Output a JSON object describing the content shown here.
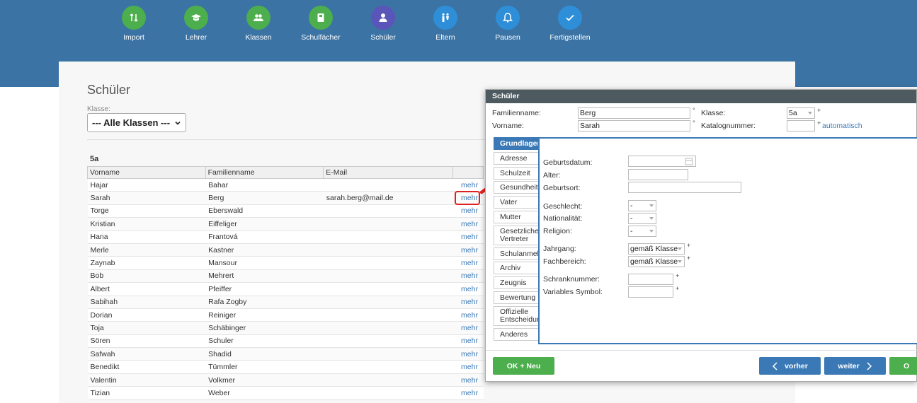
{
  "steps": [
    {
      "label": "Import",
      "icon": "import-arrows-icon",
      "color": "#4cae4c"
    },
    {
      "label": "Lehrer",
      "icon": "graduation-cap-icon",
      "color": "#4cae4c"
    },
    {
      "label": "Klassen",
      "icon": "people-group-icon",
      "color": "#4cae4c"
    },
    {
      "label": "Schulfächer",
      "icon": "book-icon",
      "color": "#4cae4c"
    },
    {
      "label": "Schüler",
      "icon": "person-icon",
      "color": "#5a55b8"
    },
    {
      "label": "Eltern",
      "icon": "parents-icon",
      "color": "#2e8fd8"
    },
    {
      "label": "Pausen",
      "icon": "bell-icon",
      "color": "#2e8fd8"
    },
    {
      "label": "Fertigstellen",
      "icon": "checkmark-icon",
      "color": "#2e8fd8"
    }
  ],
  "page": {
    "title": "Schüler",
    "klasse_label": "Klasse:",
    "klasse_value": "--- Alle Klassen ---",
    "group": "5a"
  },
  "table": {
    "headers": [
      "Vorname",
      "Familienname",
      "E-Mail",
      ""
    ],
    "more_label": "mehr",
    "rows": [
      {
        "first": "Hajar",
        "last": "Bahar",
        "email": ""
      },
      {
        "first": "Sarah",
        "last": "Berg",
        "email": "sarah.berg@mail.de"
      },
      {
        "first": "Torge",
        "last": "Eberswald",
        "email": ""
      },
      {
        "first": "Kristian",
        "last": "Eiffeliger",
        "email": ""
      },
      {
        "first": "Hana",
        "last": "Frantová",
        "email": ""
      },
      {
        "first": "Merle",
        "last": "Kastner",
        "email": ""
      },
      {
        "first": "Zaynab",
        "last": "Mansour",
        "email": ""
      },
      {
        "first": "Bob",
        "last": "Mehrert",
        "email": ""
      },
      {
        "first": "Albert",
        "last": "Pfeiffer",
        "email": ""
      },
      {
        "first": "Sabihah",
        "last": "Rafa Zogby",
        "email": ""
      },
      {
        "first": "Dorian",
        "last": "Reiniger",
        "email": ""
      },
      {
        "first": "Toja",
        "last": "Schäbinger",
        "email": ""
      },
      {
        "first": "Sören",
        "last": "Schuler",
        "email": ""
      },
      {
        "first": "Safwah",
        "last": "Shadid",
        "email": ""
      },
      {
        "first": "Benedikt",
        "last": "Tümmler",
        "email": ""
      },
      {
        "first": "Valentin",
        "last": "Volkmer",
        "email": ""
      },
      {
        "first": "Tizian",
        "last": "Weber",
        "email": ""
      }
    ]
  },
  "modal": {
    "title": "Schüler",
    "familienname_label": "Familienname:",
    "familienname_value": "Berg",
    "vorname_label": "Vorname:",
    "vorname_value": "Sarah",
    "req_mark": "°",
    "klasse_label": "Klasse:",
    "klasse_value": "5a",
    "katalog_label": "Katalognummer:",
    "katalog_value": "",
    "plus_mark": "+",
    "automatisch": "automatisch",
    "tabs": [
      "Grundlagen",
      "Adresse",
      "Schulzeit",
      "Gesundheit",
      "Vater",
      "Mutter",
      "Gesetzlicher Vertreter",
      "Schulanmeldung",
      "Archiv",
      "Zeugnis",
      "Bewertung",
      "Offizielle Entscheidungen",
      "Anderes"
    ],
    "form": {
      "geburtsdatum": "Geburtsdatum:",
      "alter": "Alter:",
      "geburtsort": "Geburtsort:",
      "geschlecht": "Geschlecht:",
      "nationalitaet": "Nationalität:",
      "religion": "Religion:",
      "dash": "-",
      "jahrgang": "Jahrgang:",
      "fachbereich": "Fachbereich:",
      "gemaess": "gemäß Klasse",
      "schranknummer": "Schranknummer:",
      "variables_symbol": "Variables Symbol:"
    },
    "buttons": {
      "ok_neu": "OK + Neu",
      "vorher": "vorher",
      "weiter": "weiter",
      "ok_partial": "O"
    }
  },
  "colors": {
    "topbar": "#3b73a4",
    "accent": "#3b79b6",
    "highlight": "#e02020"
  }
}
